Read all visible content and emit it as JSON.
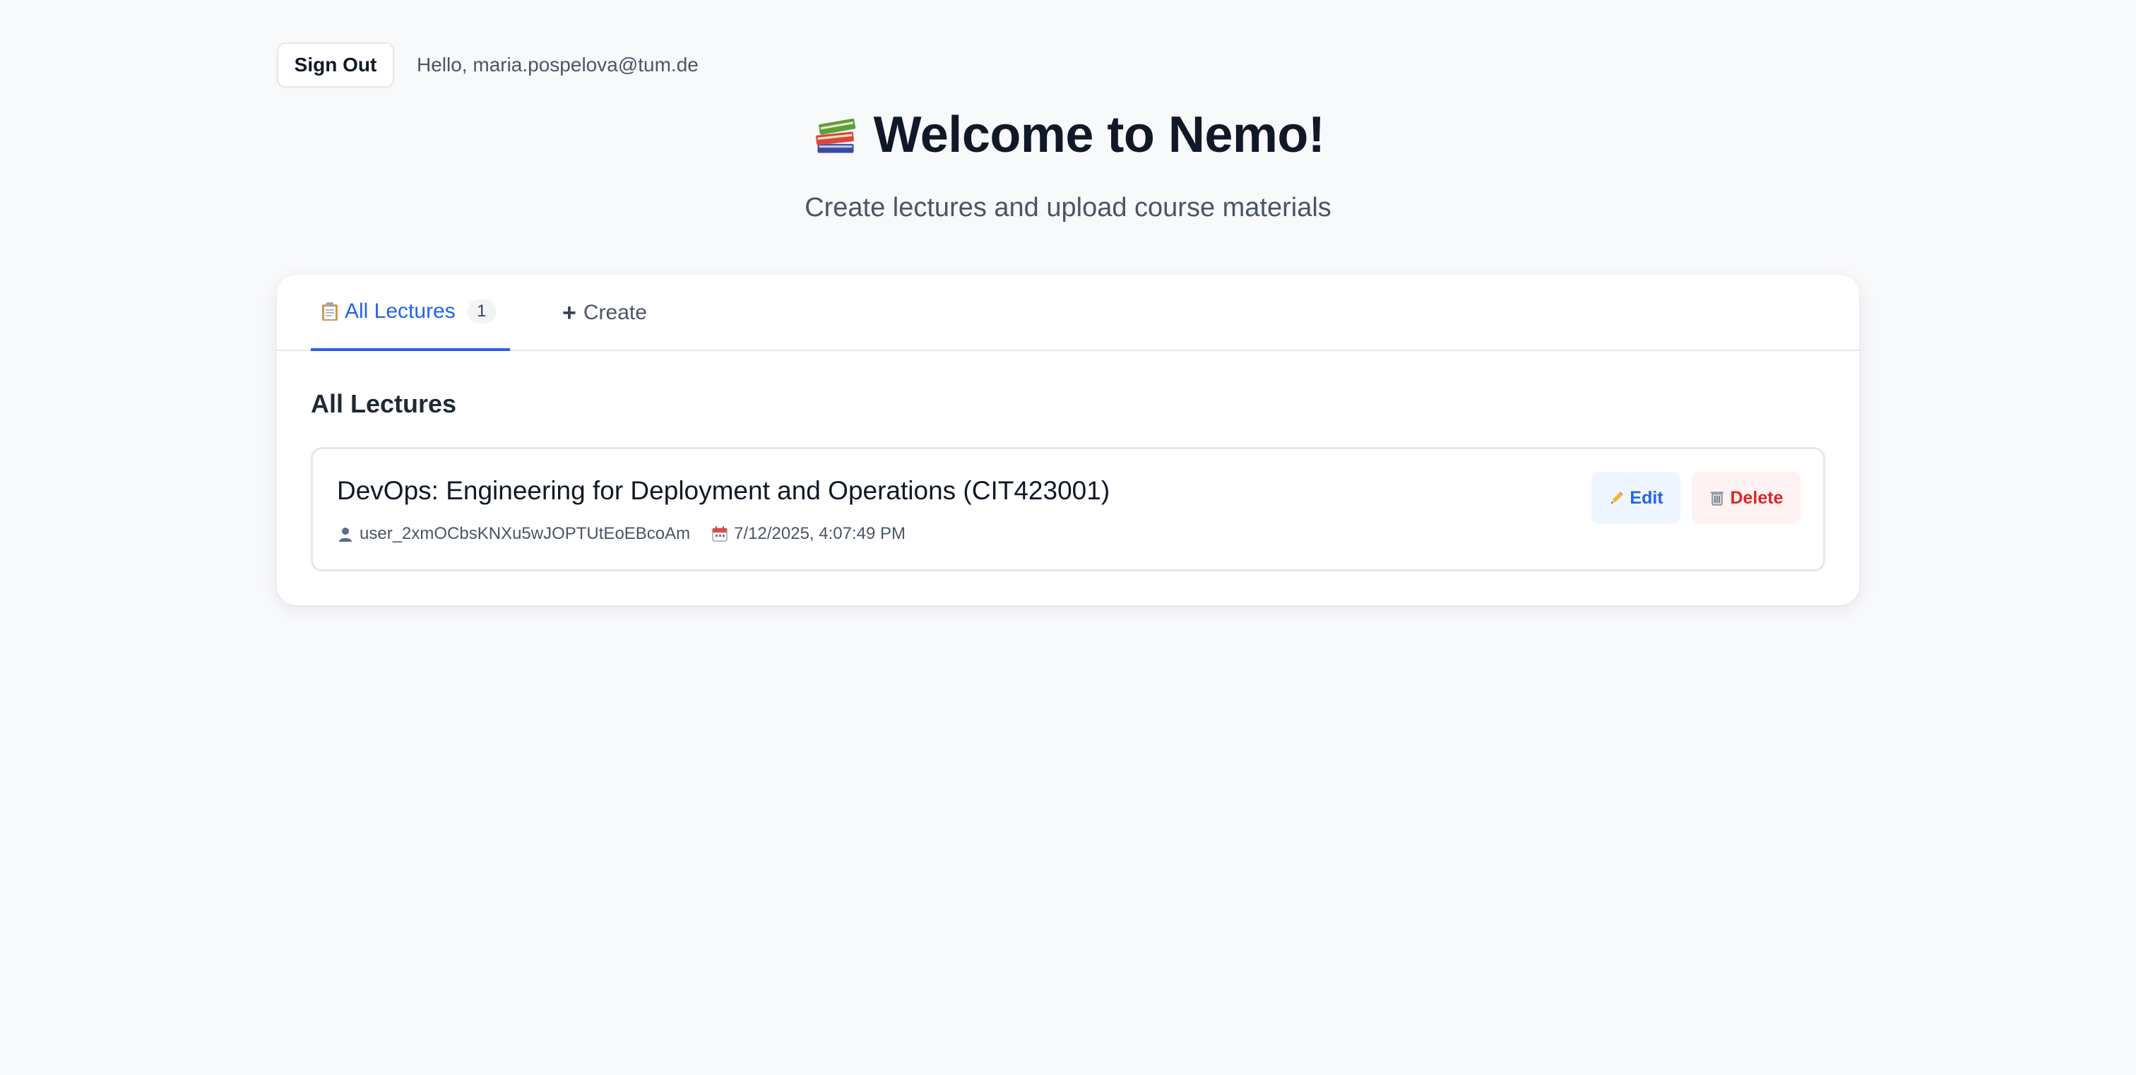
{
  "header": {
    "signout_label": "Sign Out",
    "greeting": "Hello, maria.pospelova@tum.de"
  },
  "hero": {
    "icon": "books-icon",
    "title": "Welcome to Nemo!",
    "subtitle": "Create lectures and upload course materials"
  },
  "tabs": [
    {
      "icon": "clipboard-icon",
      "label": "All Lectures",
      "count": "1",
      "active": true
    },
    {
      "icon": "plus-icon",
      "label": "Create",
      "active": false
    }
  ],
  "section": {
    "title": "All Lectures"
  },
  "lectures": [
    {
      "title": "DevOps: Engineering for Deployment and Operations (CIT423001)",
      "author_icon": "user-icon",
      "author": "user_2xmOCbsKNXu5wJOPTUtEoEBcoAm",
      "date_icon": "calendar-icon",
      "date": "7/12/2025, 4:07:49 PM",
      "edit_label": "Edit",
      "delete_label": "Delete"
    }
  ],
  "colors": {
    "background": "#f8f9fb",
    "accent": "#2563eb",
    "danger": "#dc2626",
    "text": "#111827",
    "muted": "#4b5563"
  }
}
